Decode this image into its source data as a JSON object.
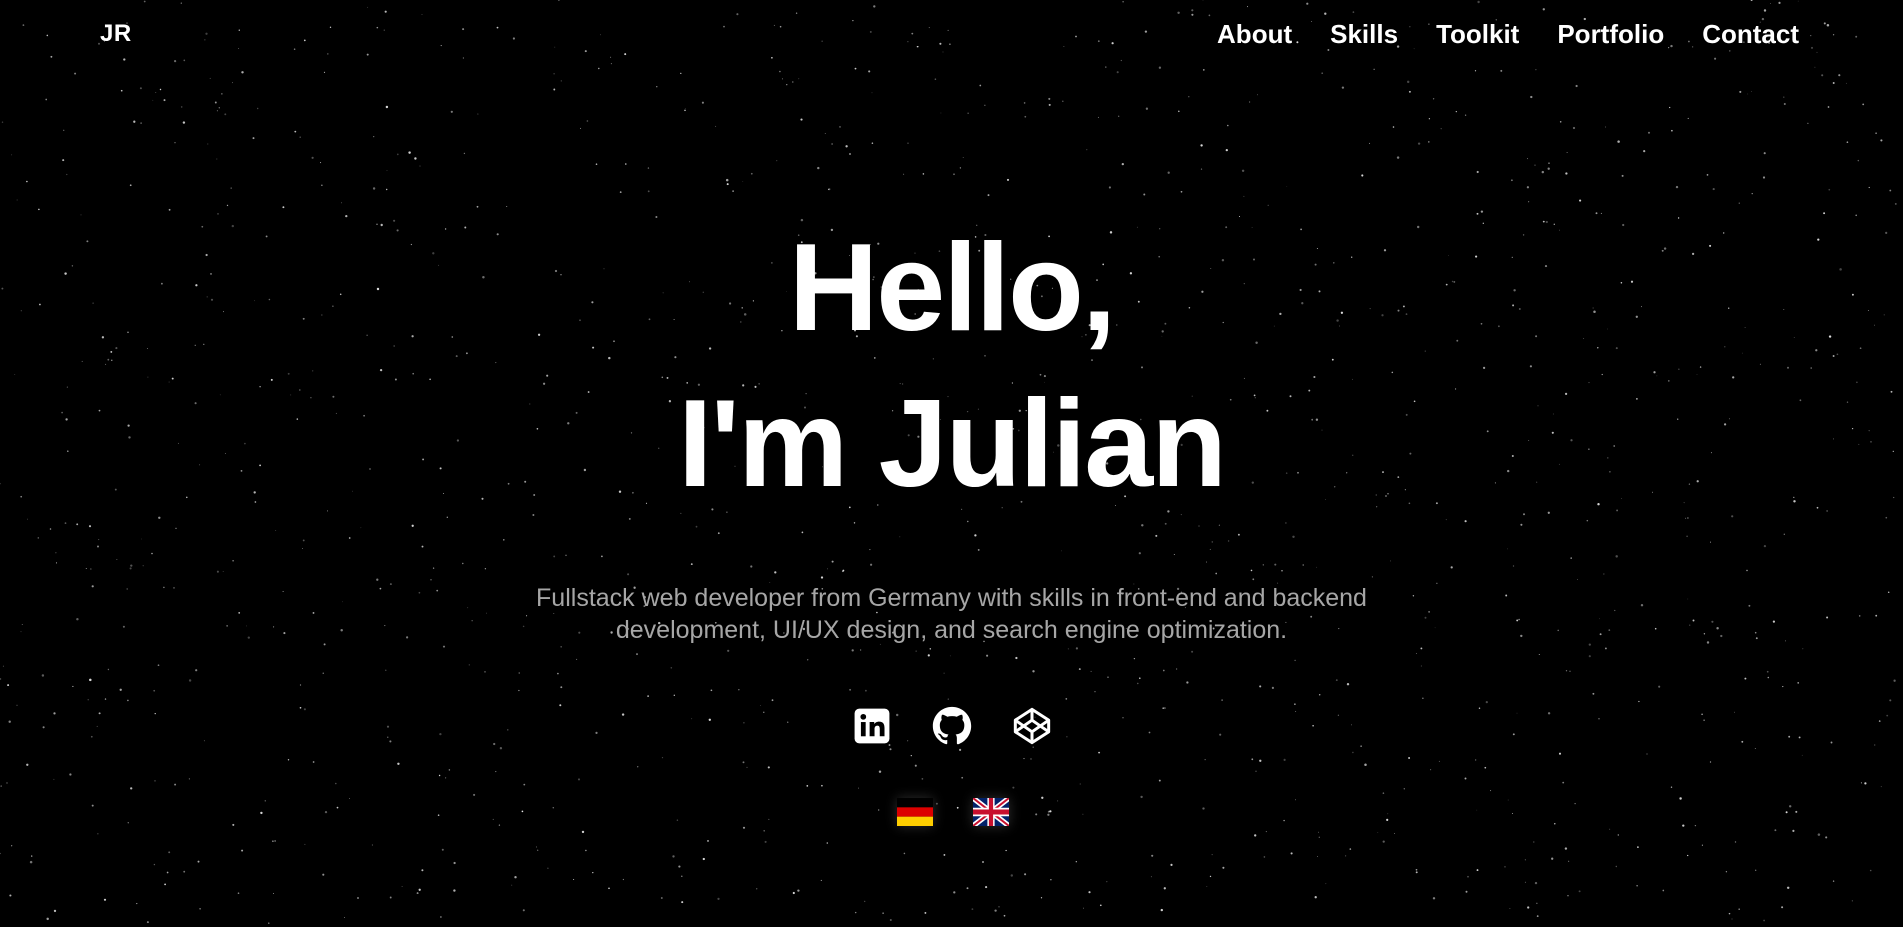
{
  "nav": {
    "logo": "JR",
    "links": [
      {
        "label": "About"
      },
      {
        "label": "Skills"
      },
      {
        "label": "Toolkit"
      },
      {
        "label": "Portfolio"
      },
      {
        "label": "Contact"
      }
    ]
  },
  "hero": {
    "title_line1": "Hello,",
    "title_line2": "I'm Julian",
    "subtitle": "Fullstack web developer from Germany with skills in front-end and backend development, UI/UX design, and search engine optimization."
  },
  "socials": [
    {
      "icon": "linkedin-icon"
    },
    {
      "icon": "github-icon"
    },
    {
      "icon": "codepen-icon"
    }
  ],
  "languages": [
    {
      "icon": "german-flag-icon"
    },
    {
      "icon": "uk-flag-icon"
    }
  ],
  "colors": {
    "background": "#000000",
    "text": "#ffffff",
    "subtitle": "#a6a6a6"
  }
}
